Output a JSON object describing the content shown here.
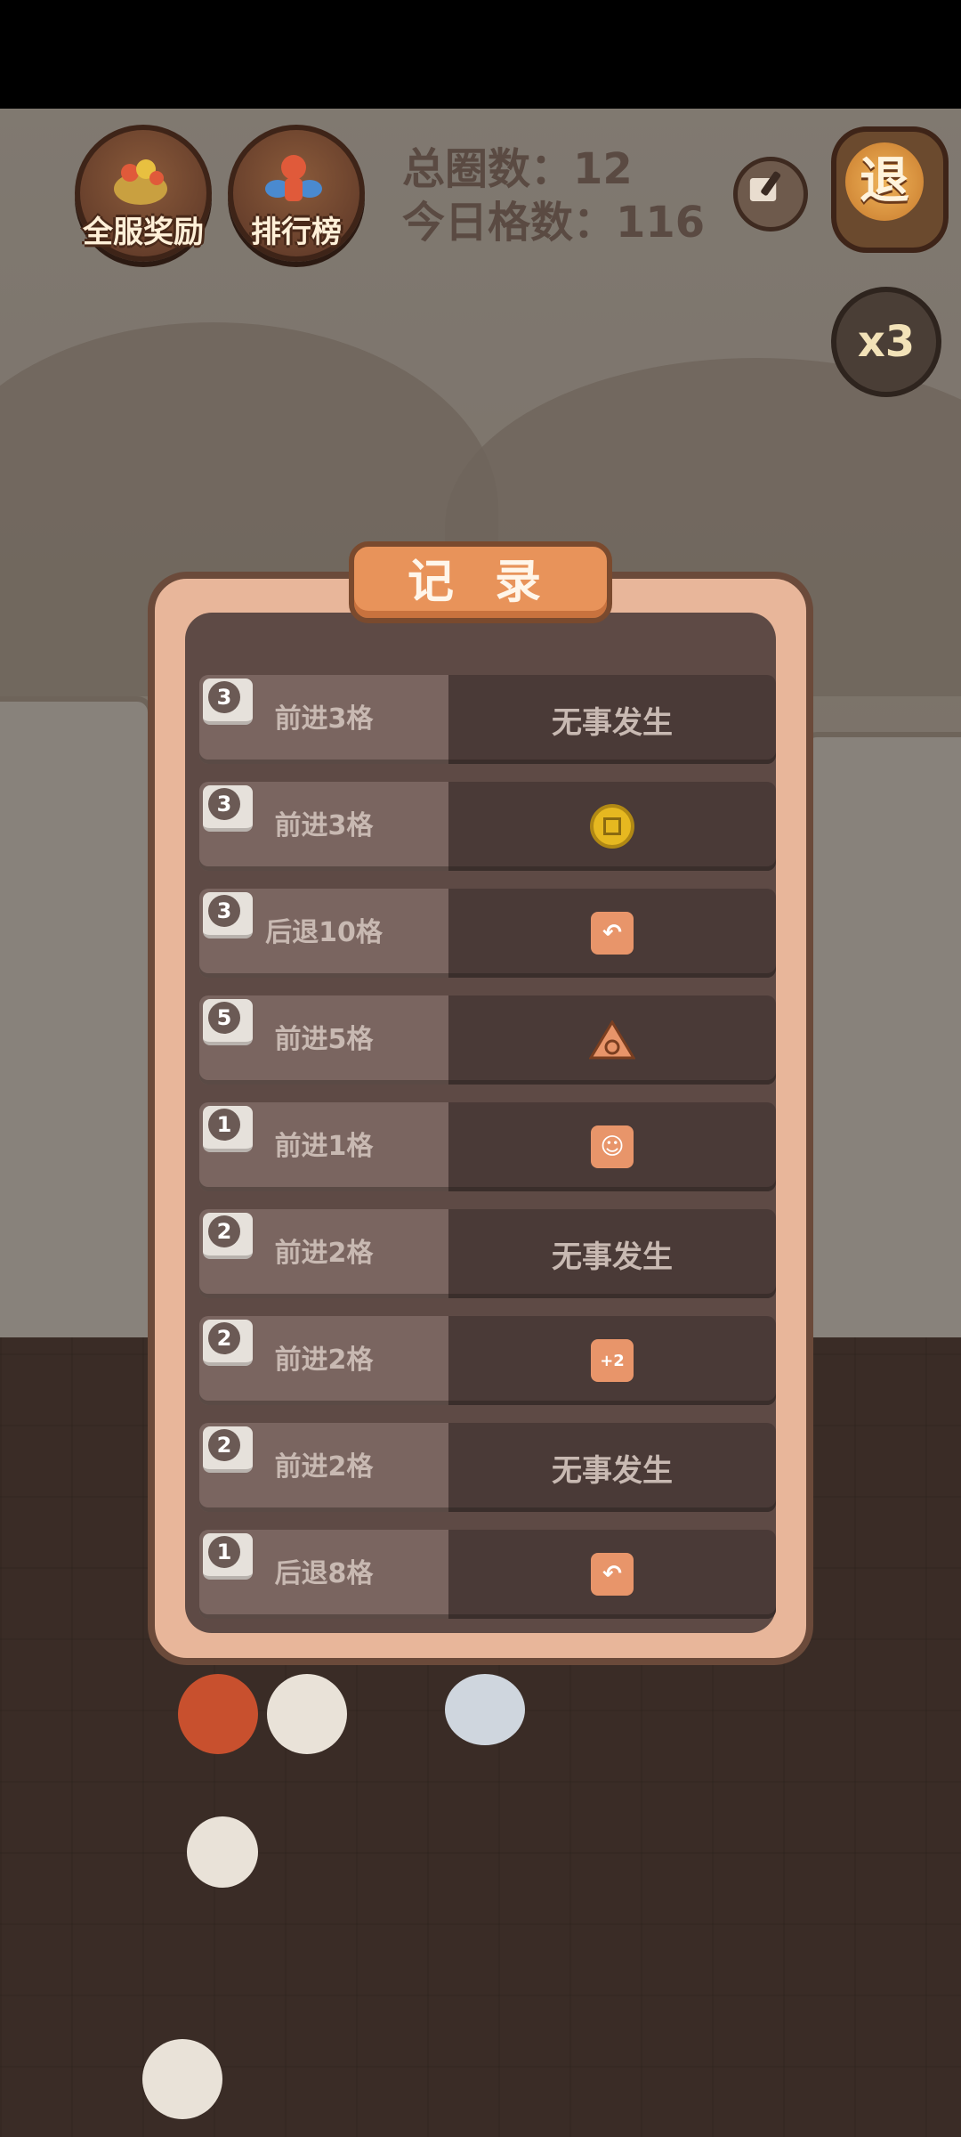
{
  "hud": {
    "server_reward_label": "全服奖励",
    "leaderboard_label": "排行榜",
    "total_laps_label": "总圈数：12",
    "today_cells_label": "今日格数：116",
    "exit_label": "退",
    "speed_label": "x3"
  },
  "modal": {
    "title": "记 录",
    "rows": [
      {
        "dice": "3",
        "step": "前进3格",
        "result_text": "无事发生",
        "result_icon": null
      },
      {
        "dice": "3",
        "step": "前进3格",
        "result_text": "",
        "result_icon": "coin-icon"
      },
      {
        "dice": "3",
        "step": "后退10格",
        "result_text": "",
        "result_icon": "back-arrow-tile-icon"
      },
      {
        "dice": "5",
        "step": "前进5格",
        "result_text": "",
        "result_icon": "triangle-swirl-icon"
      },
      {
        "dice": "1",
        "step": "前进1格",
        "result_text": "",
        "result_icon": "character-tile-icon"
      },
      {
        "dice": "2",
        "step": "前进2格",
        "result_text": "无事发生",
        "result_icon": null
      },
      {
        "dice": "2",
        "step": "前进2格",
        "result_text": "",
        "result_icon": "plus-two-tile-icon"
      },
      {
        "dice": "2",
        "step": "前进2格",
        "result_text": "无事发生",
        "result_icon": null
      },
      {
        "dice": "1",
        "step": "后退8格",
        "result_text": "",
        "result_icon": "back-arrow-tile-icon"
      }
    ]
  },
  "colors": {
    "modal_border": "#e8b69a",
    "title_tab": "#e8935a",
    "row_left": "#7a6560",
    "row_right": "#4a3a37"
  }
}
